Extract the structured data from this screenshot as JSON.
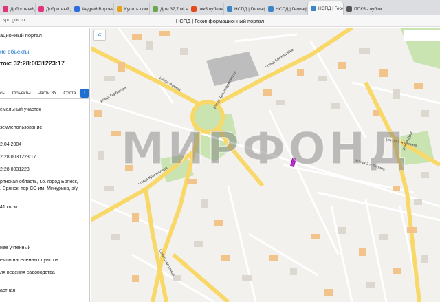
{
  "browser": {
    "tabs": [
      {
        "label": "Добротный дом",
        "color": "#e2337d"
      },
      {
        "label": "Доброт­ный дом",
        "color": "#e2337d"
      },
      {
        "label": "Андрей Воронин",
        "color": "#2a6fdb"
      },
      {
        "label": "Купить дом",
        "color": "#e7a21c"
      },
      {
        "label": "Дом 37,7 м² на ...",
        "color": "#6aa84f"
      },
      {
        "label": "пкк5 публичная",
        "color": "#e64a19"
      },
      {
        "label": "НСПД | Геоинф...",
        "color": "#3d85c6"
      },
      {
        "label": "НСПД | Геоинф...",
        "color": "#3d85c6"
      },
      {
        "label": "НСПД | Геон...",
        "color": "#3d85c6"
      },
      {
        "label": "ППК5 - публи...",
        "color": "#555555"
      }
    ],
    "active_tab_index": 8,
    "close_glyph": "×",
    "url": "spd.gov.ru",
    "page_title": "НСПД | Геоинформационный портал"
  },
  "panel": {
    "header": "ационный портал",
    "link": "ие объекты",
    "cadastral": "ток: 32:28:0031223:17",
    "tabs": [
      "сы",
      "Объекты",
      "Части ЗУ",
      "Соста"
    ],
    "tabs_arrow": "›",
    "rows": [
      "емельный участок",
      "землепользование",
      "2.04.2004",
      "2:28:0031223:17",
      "2:28:0031223",
      "рянская область, г.о. город Брянск,",
      ". Брянск, тер СО им. Мичурина, з/у",
      "41 кв. м",
      "нее учтенный",
      "емли населенных пунктов",
      "ля ведения садоводства",
      "астная"
    ]
  },
  "map": {
    "collapse_glyph": "«",
    "watermark": "МИРФОНД",
    "streets": [
      "улица Горбатова",
      "улица Фокина",
      "улица Красноармейская",
      "улица Крахмалёва",
      "улица Крахмалёва",
      "Советская улица",
      "улица Дуки",
      "улица 3-я Ляпина",
      "улица 2-я Ляпина"
    ],
    "colors": {
      "road_major": "#f9d86a",
      "road_minor": "#ffffff",
      "building": "#dcd7cf",
      "building_orange": "#f2c48b",
      "park": "#c9e3b1",
      "parcel": "#c026d3",
      "accent": "#1f6fd0"
    }
  }
}
